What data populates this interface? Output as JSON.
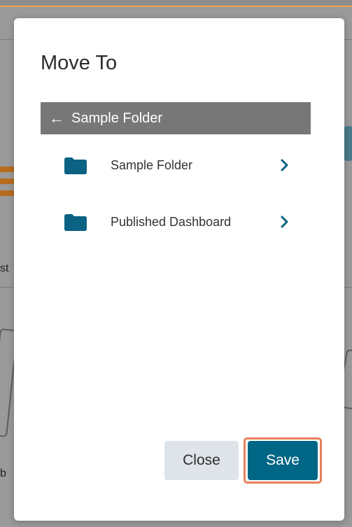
{
  "modal": {
    "title": "Move To",
    "current_folder": {
      "back_icon": "arrow-left-icon",
      "label": "Sample Folder"
    },
    "folders": [
      {
        "name": "Sample Folder",
        "icon": "folder-icon",
        "action_icon": "chevron-right-icon"
      },
      {
        "name": "Published Dashboard",
        "icon": "folder-icon",
        "action_icon": "chevron-right-icon"
      }
    ],
    "buttons": {
      "close_label": "Close",
      "save_label": "Save"
    }
  },
  "background": {
    "left_text_1": "st",
    "left_text_2": "b"
  },
  "colors": {
    "accent": "#006685",
    "folder_icon": "#0b6283",
    "header_bg": "#777777",
    "highlight_outline": "#e8805a",
    "close_button_bg": "#dfe3ea"
  }
}
